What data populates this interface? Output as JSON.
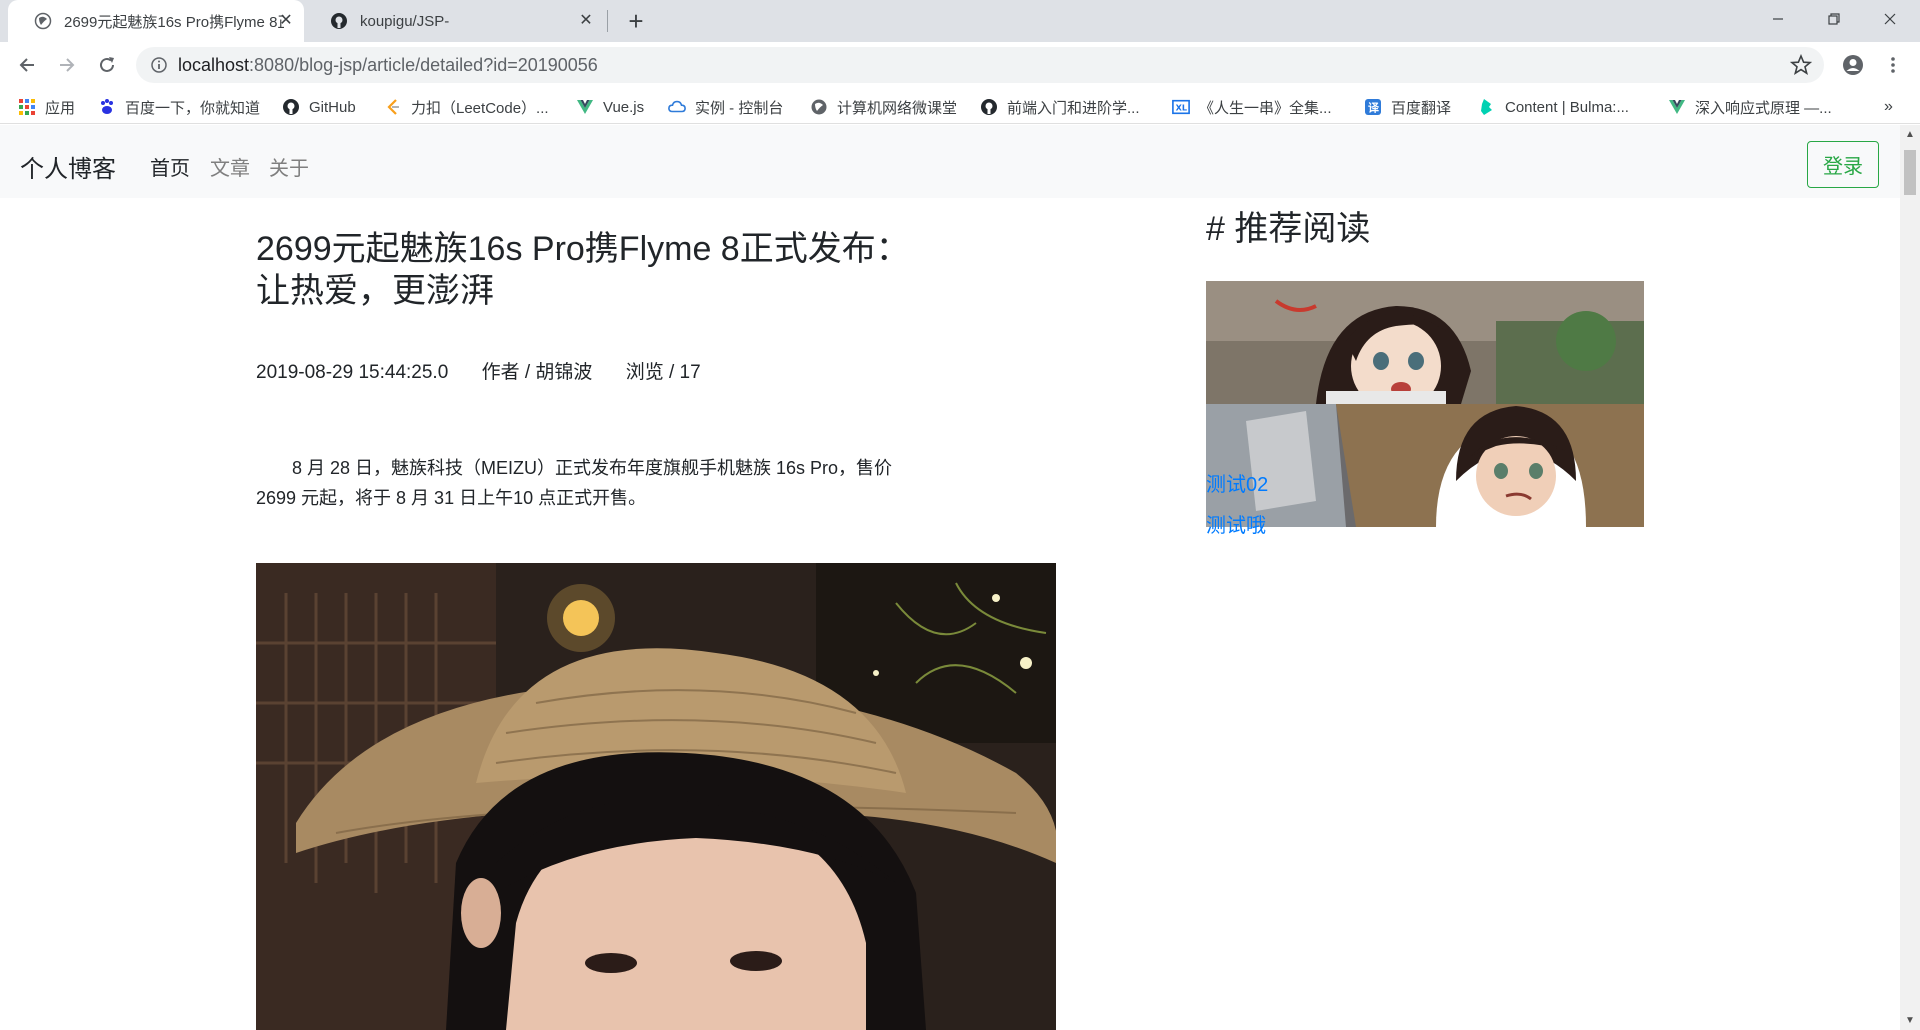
{
  "browser": {
    "tabs": [
      {
        "title": "2699元起魅族16s Pro携Flyme 8正式发布：让热爱，更澎湃",
        "icon": "globe-icon",
        "active": true
      },
      {
        "title": "koupigu/JSP-",
        "icon": "github-icon",
        "active": false
      }
    ],
    "url_host": "localhost",
    "url_path": ":8080/blog-jsp/article/detailed?id=20190056",
    "bookmarks": [
      {
        "label": "应用",
        "icon": "apps-grid-icon"
      },
      {
        "label": "百度一下，你就知道",
        "icon": "baidu-paw-icon"
      },
      {
        "label": "GitHub",
        "icon": "github-icon"
      },
      {
        "label": "力扣（LeetCode）...",
        "icon": "leetcode-icon"
      },
      {
        "label": "Vue.js",
        "icon": "vue-icon"
      },
      {
        "label": "实例 - 控制台",
        "icon": "cloud-icon"
      },
      {
        "label": "计算机网络微课堂",
        "icon": "globe-icon"
      },
      {
        "label": "前端入门和进阶学...",
        "icon": "github-icon"
      },
      {
        "label": "《人生一串》全集...",
        "icon": "video-icon"
      },
      {
        "label": "百度翻译",
        "icon": "translate-icon"
      },
      {
        "label": "Content | Bulma:...",
        "icon": "bulma-icon"
      },
      {
        "label": "深入响应式原理 —...",
        "icon": "vue-icon"
      }
    ]
  },
  "site": {
    "brand": "个人博客",
    "nav": [
      {
        "label": "首页",
        "active": true
      },
      {
        "label": "文章",
        "active": false
      },
      {
        "label": "关于",
        "active": false
      }
    ],
    "login": "登录"
  },
  "article": {
    "title": "2699元起魅族16s Pro携Flyme 8正式发布：让热爱，更澎湃",
    "date": "2019-08-29 15:44:25.0",
    "author": "作者 / 胡锦波",
    "views": "浏览 / 17",
    "paragraph": "8 月 28 日，魅族科技（MEIZU）正式发布年度旗舰手机魅族 16s Pro，售价 2699 元起，将于 8 月 31 日上午10 点正式开售。"
  },
  "sidebar": {
    "title": "# 推荐阅读",
    "links": [
      "测试02",
      "测试哦"
    ]
  },
  "colors": {
    "link": "#007bff",
    "login_border": "#28a745",
    "nav_bg": "#f8f9fa"
  }
}
